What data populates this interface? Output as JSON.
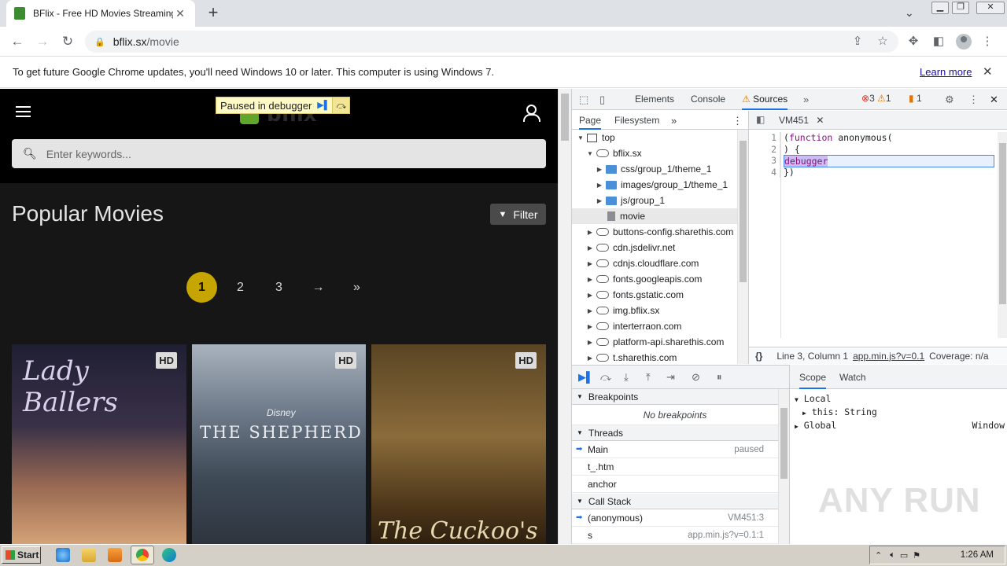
{
  "browser": {
    "tab_title": "BFlix - Free HD Movies Streaming - W",
    "tab_close": "✕",
    "new_tab": "+",
    "url_host": "bflix.sx",
    "url_path": "/movie",
    "icons": [
      "back-icon",
      "forward-icon",
      "reload-icon",
      "lock-icon",
      "share-icon",
      "star-icon",
      "extensions-icon",
      "sidepanel-icon",
      "profile-icon",
      "menu-icon"
    ]
  },
  "infobar": {
    "message": "To get future Google Chrome updates, you'll need Windows 10 or later. This computer is using Windows 7.",
    "learn_more": "Learn more",
    "close": "✕"
  },
  "site": {
    "logo_text": "bflix",
    "search_placeholder": "Enter keywords...",
    "paused_label": "Paused in debugger",
    "page_title": "Popular Movies",
    "filter_label": "Filter",
    "pagination": [
      "1",
      "2",
      "3",
      "→",
      "»"
    ],
    "active_page": "1",
    "posters": [
      {
        "title": "Lady Ballers",
        "badge": "HD"
      },
      {
        "title": "THE SHEPHERD",
        "brand": "Disney",
        "badge": "HD"
      },
      {
        "title": "The Cuckoo's Curse",
        "badge": "HD"
      }
    ]
  },
  "devtools": {
    "tabs": [
      "Elements",
      "Console",
      "Sources"
    ],
    "active_tab": "Sources",
    "errors": "3",
    "warnings": "1",
    "issues": "1",
    "navigator_tabs": [
      "Page",
      "Filesystem"
    ],
    "tree": [
      {
        "label": "top",
        "kind": "frame",
        "depth": 0,
        "open": true
      },
      {
        "label": "bflix.sx",
        "kind": "cloud",
        "depth": 1,
        "open": true
      },
      {
        "label": "css/group_1/theme_1",
        "kind": "folder",
        "depth": 2
      },
      {
        "label": "images/group_1/theme_1",
        "kind": "folder",
        "depth": 2
      },
      {
        "label": "js/group_1",
        "kind": "folder",
        "depth": 2
      },
      {
        "label": "movie",
        "kind": "file",
        "depth": 2,
        "selected": true
      },
      {
        "label": "buttons-config.sharethis.com",
        "kind": "cloud",
        "depth": 1
      },
      {
        "label": "cdn.jsdelivr.net",
        "kind": "cloud",
        "depth": 1
      },
      {
        "label": "cdnjs.cloudflare.com",
        "kind": "cloud",
        "depth": 1
      },
      {
        "label": "fonts.googleapis.com",
        "kind": "cloud",
        "depth": 1
      },
      {
        "label": "fonts.gstatic.com",
        "kind": "cloud",
        "depth": 1
      },
      {
        "label": "img.bflix.sx",
        "kind": "cloud",
        "depth": 1
      },
      {
        "label": "interterraon.com",
        "kind": "cloud",
        "depth": 1
      },
      {
        "label": "platform-api.sharethis.com",
        "kind": "cloud",
        "depth": 1
      },
      {
        "label": "t.sharethis.com",
        "kind": "cloud",
        "depth": 1
      }
    ],
    "editor_tab": "VM451",
    "code_lines": [
      {
        "n": "1",
        "text": "(function anonymous("
      },
      {
        "n": "2",
        "text": ") {"
      },
      {
        "n": "3",
        "text": "debugger"
      },
      {
        "n": "4",
        "text": "})"
      }
    ],
    "status": {
      "braces": "{}",
      "position": "Line 3, Column 1",
      "source_link": "app.min.js?v=0.1",
      "coverage": "Coverage: n/a"
    },
    "breakpoints_header": "Breakpoints",
    "no_breakpoints": "No breakpoints",
    "threads_header": "Threads",
    "threads": [
      {
        "name": "Main",
        "state": "paused",
        "current": true
      },
      {
        "name": "t_.htm",
        "state": ""
      },
      {
        "name": "anchor",
        "state": ""
      }
    ],
    "callstack_header": "Call Stack",
    "callstack": [
      {
        "name": "(anonymous)",
        "loc": "VM451:3",
        "current": true
      },
      {
        "name": "s",
        "loc": "app.min.js?v=0.1:1"
      }
    ],
    "scope_tabs": [
      "Scope",
      "Watch"
    ],
    "scope": {
      "local_label": "Local",
      "this_label": "this: String",
      "global_label": "Global",
      "global_value": "Window"
    }
  },
  "watermark": "ANY RUN",
  "taskbar": {
    "start_label": "Start",
    "clock": "1:26 AM"
  }
}
